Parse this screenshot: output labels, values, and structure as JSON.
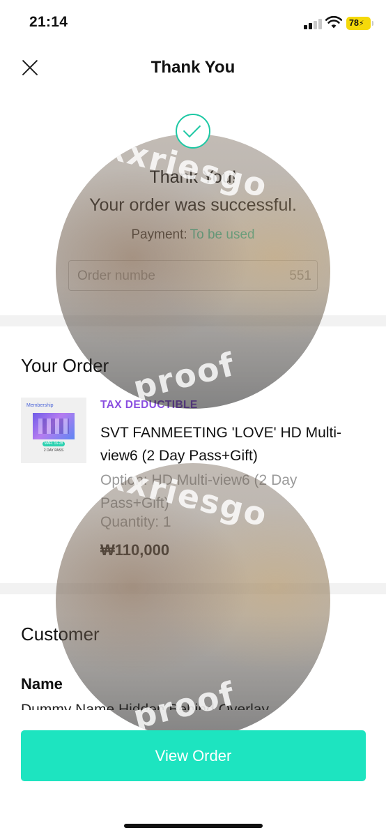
{
  "status_bar": {
    "time": "21:14",
    "battery": "78"
  },
  "header": {
    "title": "Thank You"
  },
  "hero": {
    "line1": "Thank You!",
    "line2": "Your order was successful.",
    "payment_label": "Payment:",
    "payment_value": "To be used",
    "order_number_label": "Order numbe",
    "order_number_value": "551"
  },
  "your_order": {
    "title": "Your Order",
    "thumbnail": {
      "label": "Membership",
      "date": "MAR. 16-28",
      "pass": "2 DAY PASS"
    },
    "badge": "TAX DEDUCTIBLE",
    "product_name": "SVT FANMEETING 'LOVE' HD Multi-view6 (2 Day Pass+Gift)",
    "option": "Option: HD Multi-view6 (2 Day Pass+Gift)",
    "quantity": "Quantity: 1",
    "price": "₩110,000"
  },
  "customer": {
    "title": "Customer",
    "name_label": "Name",
    "name_value": "Dummy Name Hidden Behind Overlay"
  },
  "watermark": {
    "top_text": "xxriesgo",
    "bottom_text": "proof"
  },
  "actions": {
    "view_order": "View Order"
  },
  "colors": {
    "accent": "#1dc8a4",
    "button": "#1de4c0",
    "badge": "#8a4fe0"
  }
}
